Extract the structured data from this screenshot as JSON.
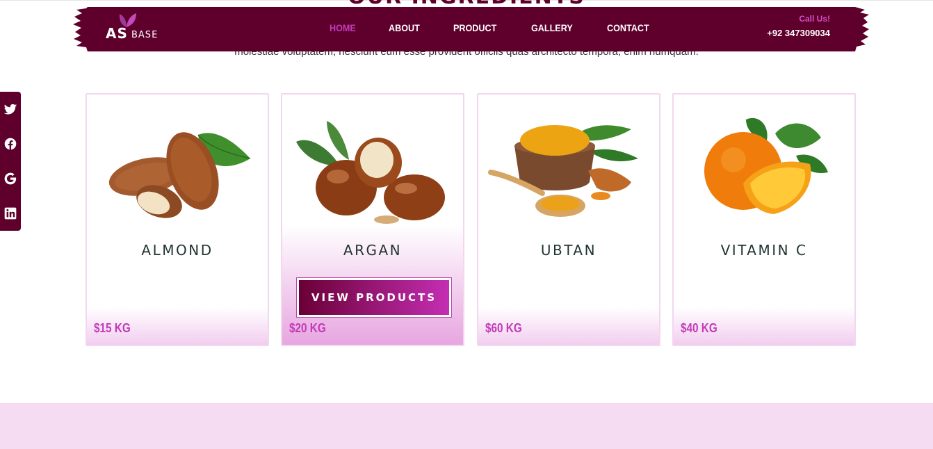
{
  "section": {
    "title": "OUR INGREDIENTS",
    "description": "molestiae voluptatem, nesciunt eum esse provident officiis quas architecto tempora, enim numquam."
  },
  "brand": {
    "logo_main": "AS",
    "logo_sub": "BASE"
  },
  "nav": {
    "items": [
      "HOME",
      "ABOUT",
      "PRODUCT",
      "GALLERY",
      "CONTACT"
    ],
    "active": "HOME"
  },
  "contact": {
    "label": "Call Us!",
    "phone": "+92 347309034"
  },
  "social": {
    "icons": [
      "twitter-icon",
      "facebook-icon",
      "google-icon",
      "linkedin-icon"
    ]
  },
  "products": [
    {
      "name": "ALMOND",
      "price": "$15 KG",
      "image": "almond"
    },
    {
      "name": "ARGAN",
      "price": "$20 KG",
      "image": "argan",
      "button": "VIEW PRODUCTS"
    },
    {
      "name": "UBTAN",
      "price": "$60 KG",
      "image": "turmeric"
    },
    {
      "name": "VITAMIN C",
      "price": "$40 KG",
      "image": "orange"
    }
  ],
  "colors": {
    "header_bg": "#5e002b",
    "accent": "#c23bb8",
    "footer_band": "#f5dcf2"
  }
}
